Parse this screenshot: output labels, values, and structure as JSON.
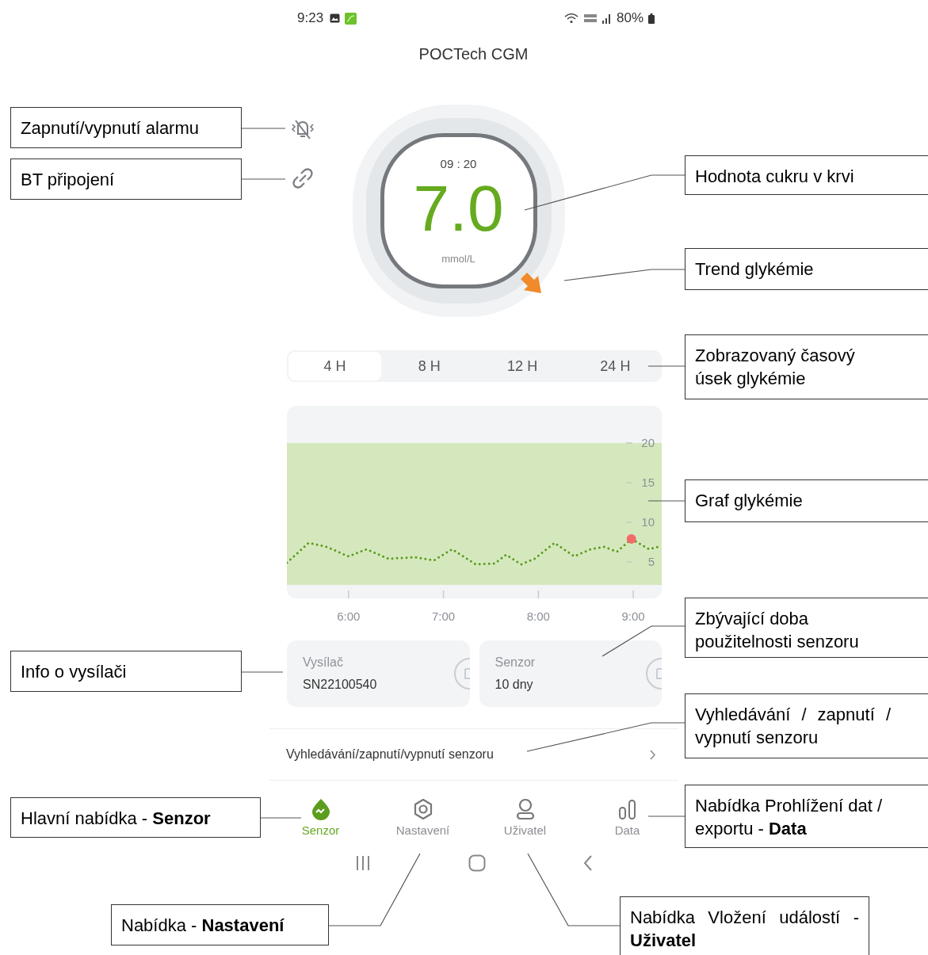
{
  "status_bar": {
    "time": "9:23",
    "battery": "80%"
  },
  "app_title": "POCTech CGM",
  "reading": {
    "time": "09 : 20",
    "value": "7.0",
    "unit": "mmol/L"
  },
  "range_tabs": [
    {
      "label": "4 H",
      "selected": true
    },
    {
      "label": "8 H",
      "selected": false
    },
    {
      "label": "12 H",
      "selected": false
    },
    {
      "label": "24 H",
      "selected": false
    }
  ],
  "chart": {
    "chart_data": {
      "type": "line",
      "x": [
        5.35,
        5.58,
        5.77,
        6.0,
        6.19,
        6.42,
        6.7,
        6.9,
        7.09,
        7.34,
        7.54,
        7.66,
        7.82,
        7.96,
        8.17,
        8.38,
        8.55,
        8.69,
        8.83,
        8.98,
        9.17,
        9.29
      ],
      "series": [
        {
          "color": "#5c9a1c",
          "line_style": "dotted",
          "values": [
            4.9,
            7.4,
            6.9,
            5.7,
            6.6,
            5.4,
            5.6,
            5.2,
            6.6,
            4.7,
            4.8,
            5.9,
            4.7,
            5.4,
            7.4,
            5.7,
            6.6,
            6.9,
            6.3,
            7.9,
            6.6,
            7.0
          ]
        },
        {
          "color": "#f26b6b",
          "line_style": "none",
          "marker": "circle",
          "values": [
            null,
            null,
            null,
            null,
            null,
            null,
            null,
            null,
            null,
            null,
            null,
            null,
            null,
            null,
            null,
            null,
            null,
            null,
            null,
            7.9,
            null,
            null
          ]
        }
      ],
      "bands": [
        {
          "axis": "y",
          "from": 2.1,
          "to": 20,
          "color": "#d5e8bd"
        }
      ],
      "xlim": [
        5.35,
        9.3
      ],
      "ylim": [
        0.4,
        24.7
      ],
      "xticks": [
        {
          "value": 6,
          "label": "6:00"
        },
        {
          "value": 7,
          "label": "7:00"
        },
        {
          "value": 8,
          "label": "8:00"
        },
        {
          "value": 9,
          "label": "9:00"
        }
      ],
      "yticks": [
        5,
        10,
        15,
        20
      ]
    }
  },
  "cards": [
    {
      "label": "Vysílač",
      "value": "SN22100540"
    },
    {
      "label": "Senzor",
      "value": "10 dny"
    }
  ],
  "sensor_link": {
    "label": "Vyhledávání/zapnutí/vypnutí senzoru"
  },
  "nav": [
    {
      "label": "Senzor",
      "kind": "sensor",
      "selected": true
    },
    {
      "label": "Nastavení",
      "kind": "settings",
      "selected": false
    },
    {
      "label": "Uživatel",
      "kind": "user",
      "selected": false
    },
    {
      "label": "Data",
      "kind": "data",
      "selected": false
    }
  ],
  "callouts": [
    "Zapnutí/vypnutí alarmu",
    "BT připojení",
    "Hodnota cukru v krvi",
    "Trend glykémie",
    "Zobrazovaný časový úsek glykémie",
    "Graf glykémie",
    "Zbývající doba použitelnosti senzoru",
    "Info o vysílači",
    "Vyhledávání / zapnutí / vypnutí senzoru",
    "Hlavní nabídka -  **Senzor**",
    "Nabídka Prohlížení dat / exportu -  **Data**",
    "Nabídka -  **Nastavení**",
    "Nabídka Vložení událostí -  **Uživatel**"
  ]
}
